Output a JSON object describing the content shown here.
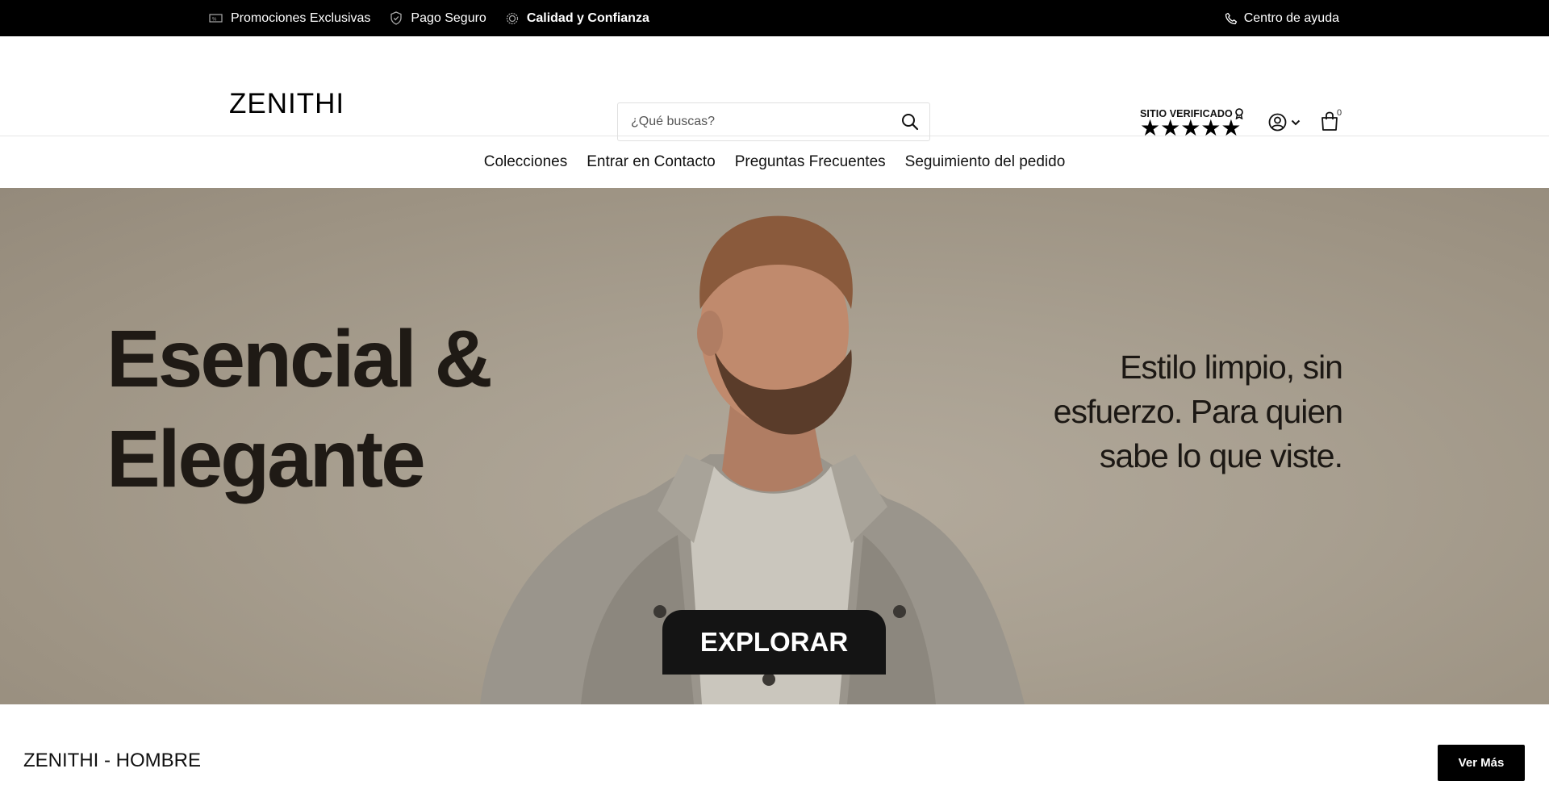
{
  "topbar": {
    "promo": "Promociones Exclusivas",
    "secure": "Pago Seguro",
    "quality": "Calidad y Confianza",
    "help": "Centro de ayuda"
  },
  "header": {
    "logo": "ZENITHI",
    "search_placeholder": "¿Qué buscas?",
    "verified_label": "SITIO VERIFICADO",
    "stars": "★★★★★",
    "cart_count": "0"
  },
  "nav": {
    "items": [
      "Colecciones",
      "Entrar en Contacto",
      "Preguntas Frecuentes",
      "Seguimiento del pedido"
    ]
  },
  "hero": {
    "headline_line1": "Esencial &",
    "headline_line2": "Elegante",
    "tagline_line1": "Estilo limpio, sin",
    "tagline_line2": "esfuerzo. Para quien",
    "tagline_line3": "sabe lo que viste.",
    "cta": "EXPLORAR"
  },
  "section": {
    "title": "ZENITHI - HOMBRE",
    "more_button": "Ver Más"
  },
  "colors": {
    "topbar_bg": "#000000",
    "hero_bg": "#a89f90",
    "button_bg": "#000000"
  }
}
